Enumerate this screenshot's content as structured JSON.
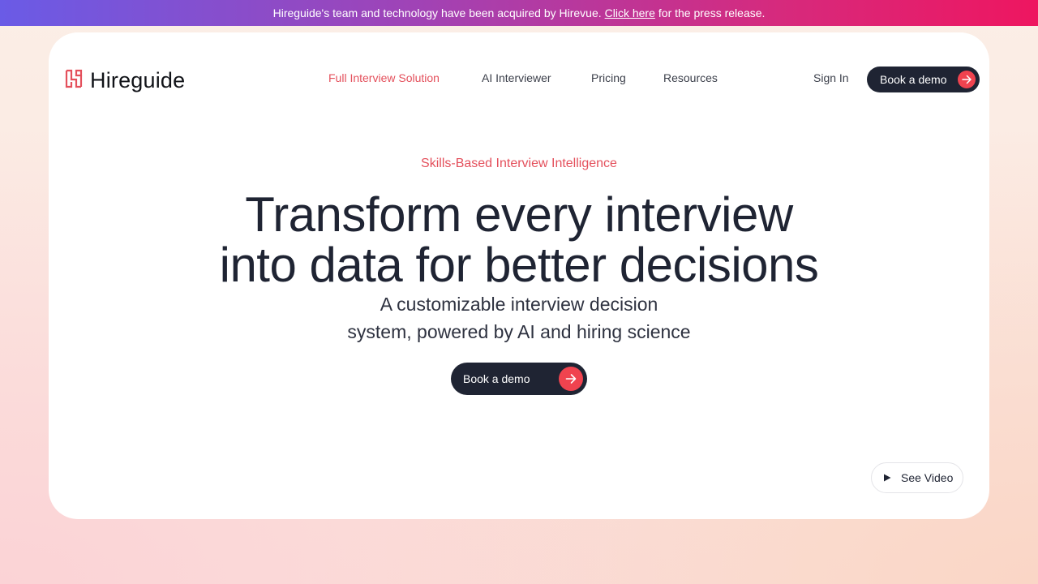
{
  "banner": {
    "text_before": "Hireguide's team and technology have been acquired by Hirevue.",
    "link_label": "Click here",
    "text_after": "for the press release."
  },
  "logo": {
    "text": "Hireguide",
    "icon": "hireguide-logo-icon"
  },
  "nav": {
    "items": [
      {
        "label": "Full Interview Solution",
        "active": true
      },
      {
        "label": "AI Interviewer",
        "active": false
      },
      {
        "label": "Pricing",
        "active": false
      },
      {
        "label": "Resources",
        "active": false
      }
    ],
    "sign_in_label": "Sign In",
    "book_demo_label": "Book a demo"
  },
  "hero": {
    "eyebrow": "Skills-Based Interview Intelligence",
    "headline_line1": "Transform every interview",
    "headline_line2": "into data for better decisions",
    "subhead_line1": "A customizable interview decision",
    "subhead_line2": "system, powered by AI and hiring science",
    "cta_label": "Book a demo"
  },
  "video": {
    "label": "See Video",
    "icon": "play-icon"
  },
  "colors": {
    "accent": "#e4505c",
    "arrow_bg": "#f0434f",
    "dark": "#1f2433",
    "banner_start": "#6a5be6",
    "banner_end": "#ee1660"
  }
}
